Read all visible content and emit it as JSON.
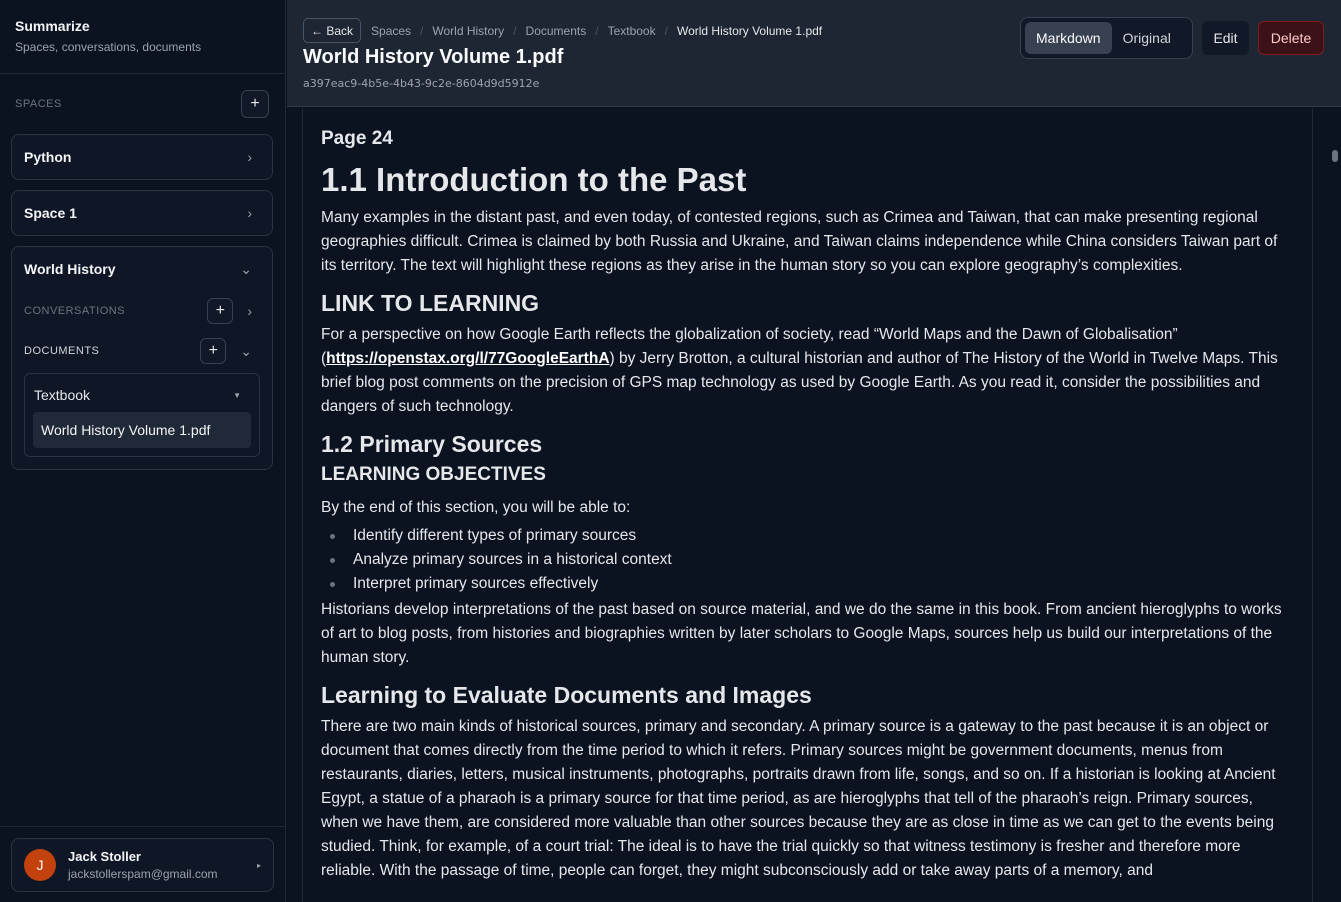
{
  "app": {
    "title": "Summarize",
    "subtitle": "Spaces, conversations, documents"
  },
  "sidebar": {
    "spaces_label": "SPACES",
    "spaces": [
      {
        "name": "Python"
      },
      {
        "name": "Space 1"
      },
      {
        "name": "World History"
      }
    ],
    "conversations_label": "CONVERSATIONS",
    "documents_label": "DOCUMENTS",
    "folder": "Textbook",
    "file": "World History Volume 1.pdf"
  },
  "user": {
    "initial": "J",
    "name": "Jack Stoller",
    "email": "jackstollerspam@gmail.com"
  },
  "header": {
    "back": "← Back",
    "crumbs": [
      "Spaces",
      "World History",
      "Documents",
      "Textbook",
      "World History Volume 1.pdf"
    ],
    "title": "World History Volume 1.pdf",
    "doc_id": "a397eac9-4b5e-4b43-9c2e-8604d9d5912e",
    "view_markdown": "Markdown",
    "view_original": "Original",
    "edit": "Edit",
    "delete": "Delete"
  },
  "content": {
    "page": "Page 24",
    "h1": "1.1 Introduction to the Past",
    "p1": "Many examples in the distant past, and even today, of contested regions, such as Crimea and Taiwan, that can make presenting regional geographies difficult. Crimea is claimed by both Russia and Ukraine, and Taiwan claims independence while China considers Taiwan part of its territory. The text will highlight these regions as they arise in the human story so you can explore geography’s complexities.",
    "h2_link": "LINK TO LEARNING",
    "p2_before": "For a perspective on how Google Earth reflects the globalization of society, read “World Maps and the Dawn of Globalisation” (",
    "p2_link": "https://openstax.org/l/77GoogleEarthA",
    "p2_after": ") by Jerry Brotton, a cultural historian and author of The History of the World in Twelve Maps. This brief blog post comments on the precision of GPS map technology as used by Google Earth. As you read it, consider the possibilities and dangers of such technology.",
    "h2_primary": "1.2 Primary Sources",
    "h3_objectives": "LEARNING OBJECTIVES",
    "p3": "By the end of this section, you will be able to:",
    "objectives": [
      "Identify different types of primary sources",
      "Analyze primary sources in a historical context",
      "Interpret primary sources effectively"
    ],
    "p4": "Historians develop interpretations of the past based on source material, and we do the same in this book. From ancient hieroglyphs to works of art to blog posts, from histories and biographies written by later scholars to Google Maps, sources help us build our interpretations of the human story.",
    "h2_evaluate": "Learning to Evaluate Documents and Images",
    "p5": "There are two main kinds of historical sources, primary and secondary. A primary source is a gateway to the past because it is an object or document that comes directly from the time period to which it refers. Primary sources might be government documents, menus from restaurants, diaries, letters, musical instruments, photographs, portraits drawn from life, songs, and so on. If a historian is looking at Ancient Egypt, a statue of a pharaoh is a primary source for that time period, as are hieroglyphs that tell of the pharaoh’s reign. Primary sources, when we have them, are considered more valuable than other sources because they are as close in time as we can get to the events being studied. Think, for example, of a court trial: The ideal is to have the trial quickly so that witness testimony is fresher and therefore more reliable. With the passage of time, people can forget, they might subconsciously add or take away parts of a memory, and"
  }
}
